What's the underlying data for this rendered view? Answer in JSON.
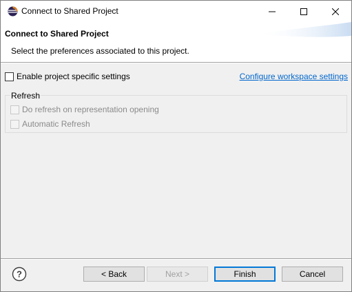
{
  "window": {
    "title": "Connect to Shared Project",
    "controls": {
      "minimize": "minimize",
      "maximize": "maximize",
      "close": "close"
    }
  },
  "banner": {
    "title": "Connect to Shared Project",
    "description": "Select the preferences associated to this project."
  },
  "settings": {
    "enable_label": "Enable project specific settings",
    "enable_checked": false,
    "configure_link": "Configure workspace settings"
  },
  "refresh_group": {
    "title": "Refresh",
    "options": [
      {
        "label": "Do refresh on representation opening",
        "checked": false,
        "enabled": false
      },
      {
        "label": "Automatic Refresh",
        "checked": false,
        "enabled": false
      }
    ]
  },
  "buttons": {
    "back": "< Back",
    "next": "Next >",
    "finish": "Finish",
    "cancel": "Cancel"
  },
  "icons": {
    "app": "eclipse-icon",
    "help": "help-icon"
  },
  "colors": {
    "link": "#0066cc",
    "default_button_border": "#0078d7"
  }
}
